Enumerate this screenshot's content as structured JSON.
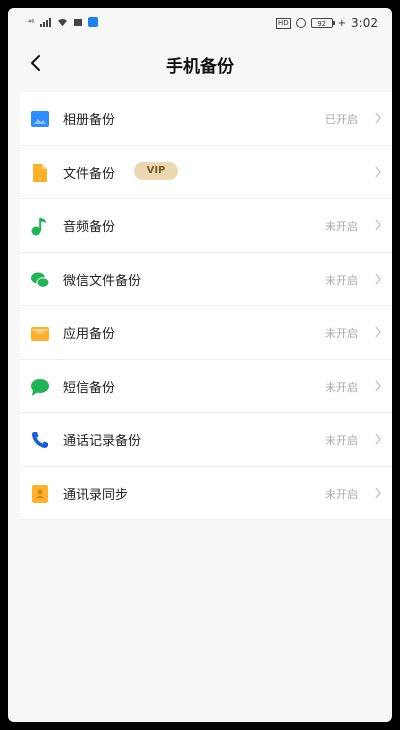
{
  "status_bar": {
    "signal_label": "⁴⁶",
    "battery_label": "92",
    "charging_symbol": "+",
    "time": "3:02",
    "hd_label": "HD"
  },
  "header": {
    "title": "手机备份",
    "back_icon": "chevron-left-icon"
  },
  "items": [
    {
      "label": "相册备份",
      "status": "已开启",
      "icon": "photo-icon",
      "color": "#2f8cff"
    },
    {
      "label": "文件备份",
      "status": "",
      "badge": "VIP",
      "icon": "file-icon",
      "color": "#ffb12b"
    },
    {
      "label": "音频备份",
      "status": "未开启",
      "icon": "music-icon",
      "color": "#1fb556"
    },
    {
      "label": "微信文件备份",
      "status": "未开启",
      "icon": "wechat-icon",
      "color": "#1fb556"
    },
    {
      "label": "应用备份",
      "status": "未开启",
      "icon": "app-box-icon",
      "color": "#ffb12b"
    },
    {
      "label": "短信备份",
      "status": "未开启",
      "icon": "message-icon",
      "color": "#1fb556"
    },
    {
      "label": "通话记录备份",
      "status": "未开启",
      "icon": "phone-icon",
      "color": "#1a5fd6"
    },
    {
      "label": "通讯录同步",
      "status": "未开启",
      "icon": "contacts-icon",
      "color": "#ffb12b"
    }
  ]
}
